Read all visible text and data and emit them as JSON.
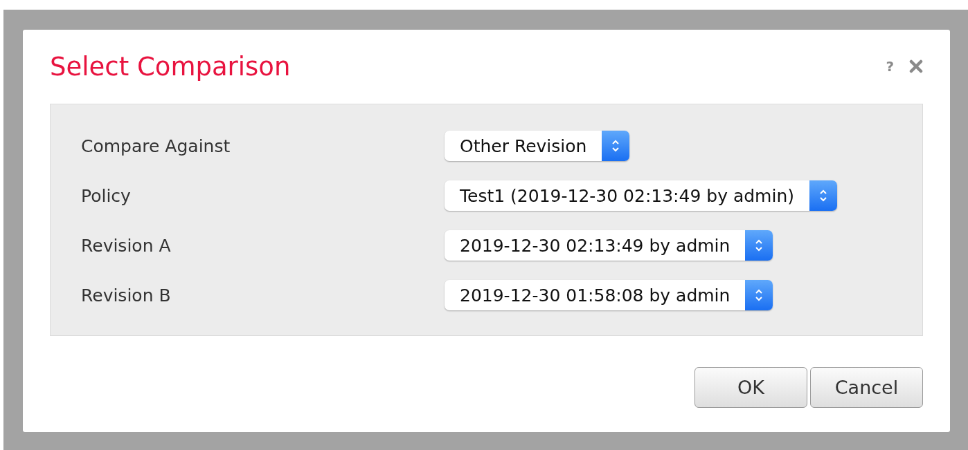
{
  "dialog": {
    "title": "Select Comparison",
    "help": "?"
  },
  "fields": [
    {
      "label": "Compare Against",
      "value": "Other Revision"
    },
    {
      "label": "Policy",
      "value": "Test1 (2019-12-30 02:13:49 by admin)"
    },
    {
      "label": "Revision A",
      "value": "2019-12-30 02:13:49 by admin"
    },
    {
      "label": "Revision B",
      "value": "2019-12-30 01:58:08 by admin"
    }
  ],
  "buttons": [
    "OK",
    "Cancel"
  ]
}
